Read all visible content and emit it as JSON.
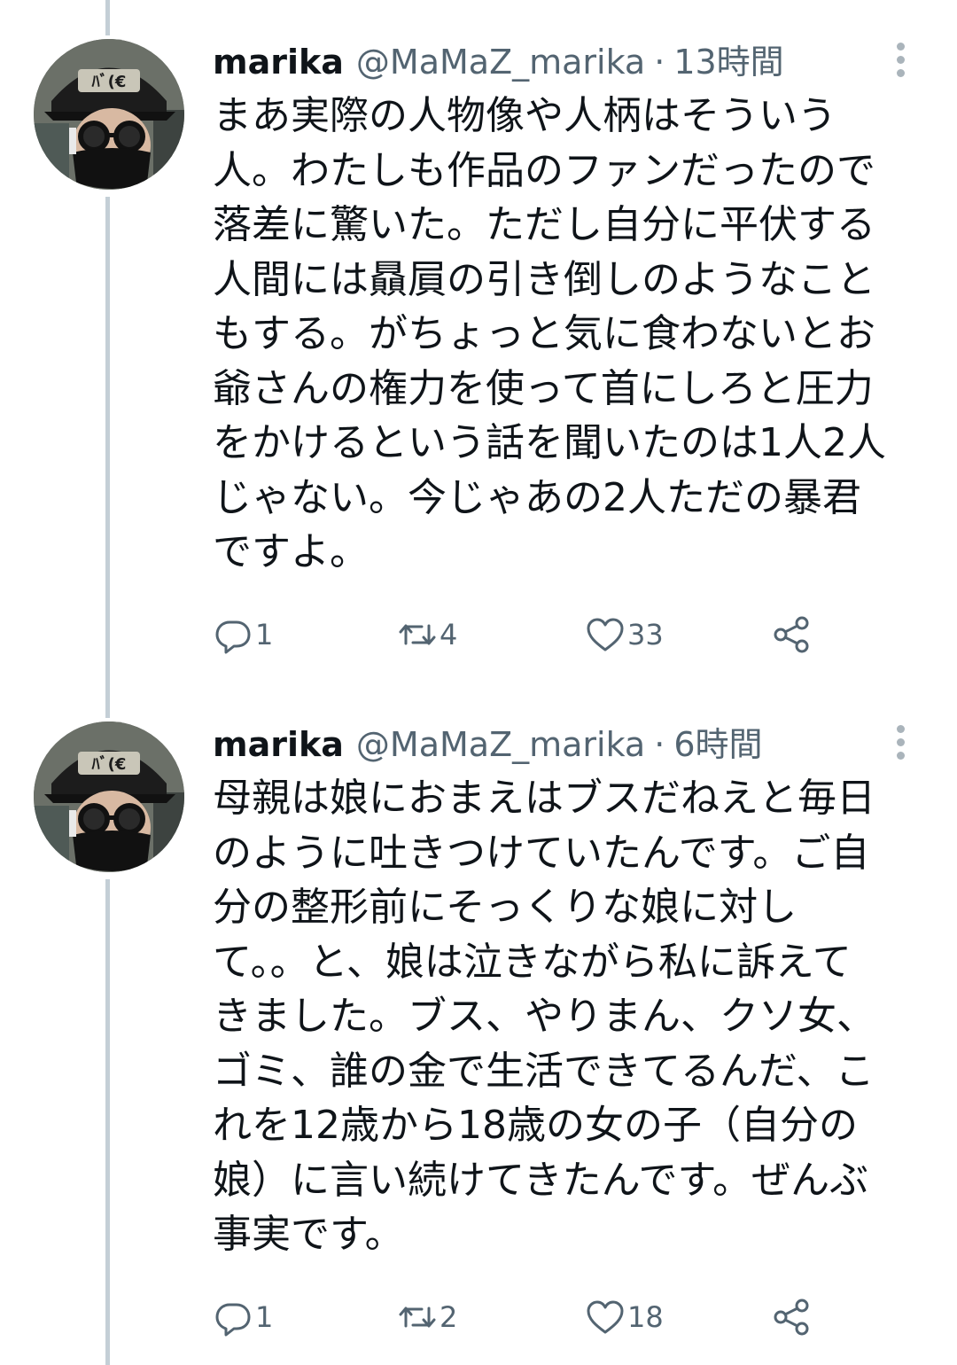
{
  "tweets": [
    {
      "display_name": "marika",
      "handle": "@MaMaZ_marika",
      "separator": "·",
      "time": "13時間",
      "text": "まあ実際の人物像や人柄はそういう\n人。わたしも作品のファンだったので\n落差に驚いた。ただし自分に平伏する\n人間には贔屓の引き倒しのようなこと\nもする。がちょっと気に食わないとお\n爺さんの権力を使って首にしろと圧力\nをかけるという話を聞いたのは1人2人\nじゃない。今じゃあの2人ただの暴君\nですよ。",
      "stats": {
        "replies": "1",
        "retweets": "4",
        "likes": "33"
      },
      "icons": [
        "reply-icon",
        "retweet-icon",
        "like-icon",
        "share-icon",
        "more-icon"
      ]
    },
    {
      "display_name": "marika",
      "handle": "@MaMaZ_marika",
      "separator": "·",
      "time": "6時間",
      "text": "母親は娘におまえはブスだねえと毎日\nのように吐きつけていたんです。ご自\n分の整形前にそっくりな娘に対し\nて。。と、娘は泣きながら私に訴えて\nきました。ブス、やりまん、クソ女、\nゴミ、誰の金で生活できてるんだ、こ\nれを12歳から18歳の女の子（自分の\n娘）に言い続けてきたんです。ぜんぶ\n事実です。",
      "stats": {
        "replies": "1",
        "retweets": "2",
        "likes": "18"
      },
      "icons": [
        "reply-icon",
        "retweet-icon",
        "like-icon",
        "share-icon",
        "more-icon"
      ]
    }
  ],
  "colors": {
    "text_primary": "#0f1419",
    "text_secondary": "#536471",
    "thread_line": "#c4cfd6",
    "icon_gray": "#536471"
  }
}
